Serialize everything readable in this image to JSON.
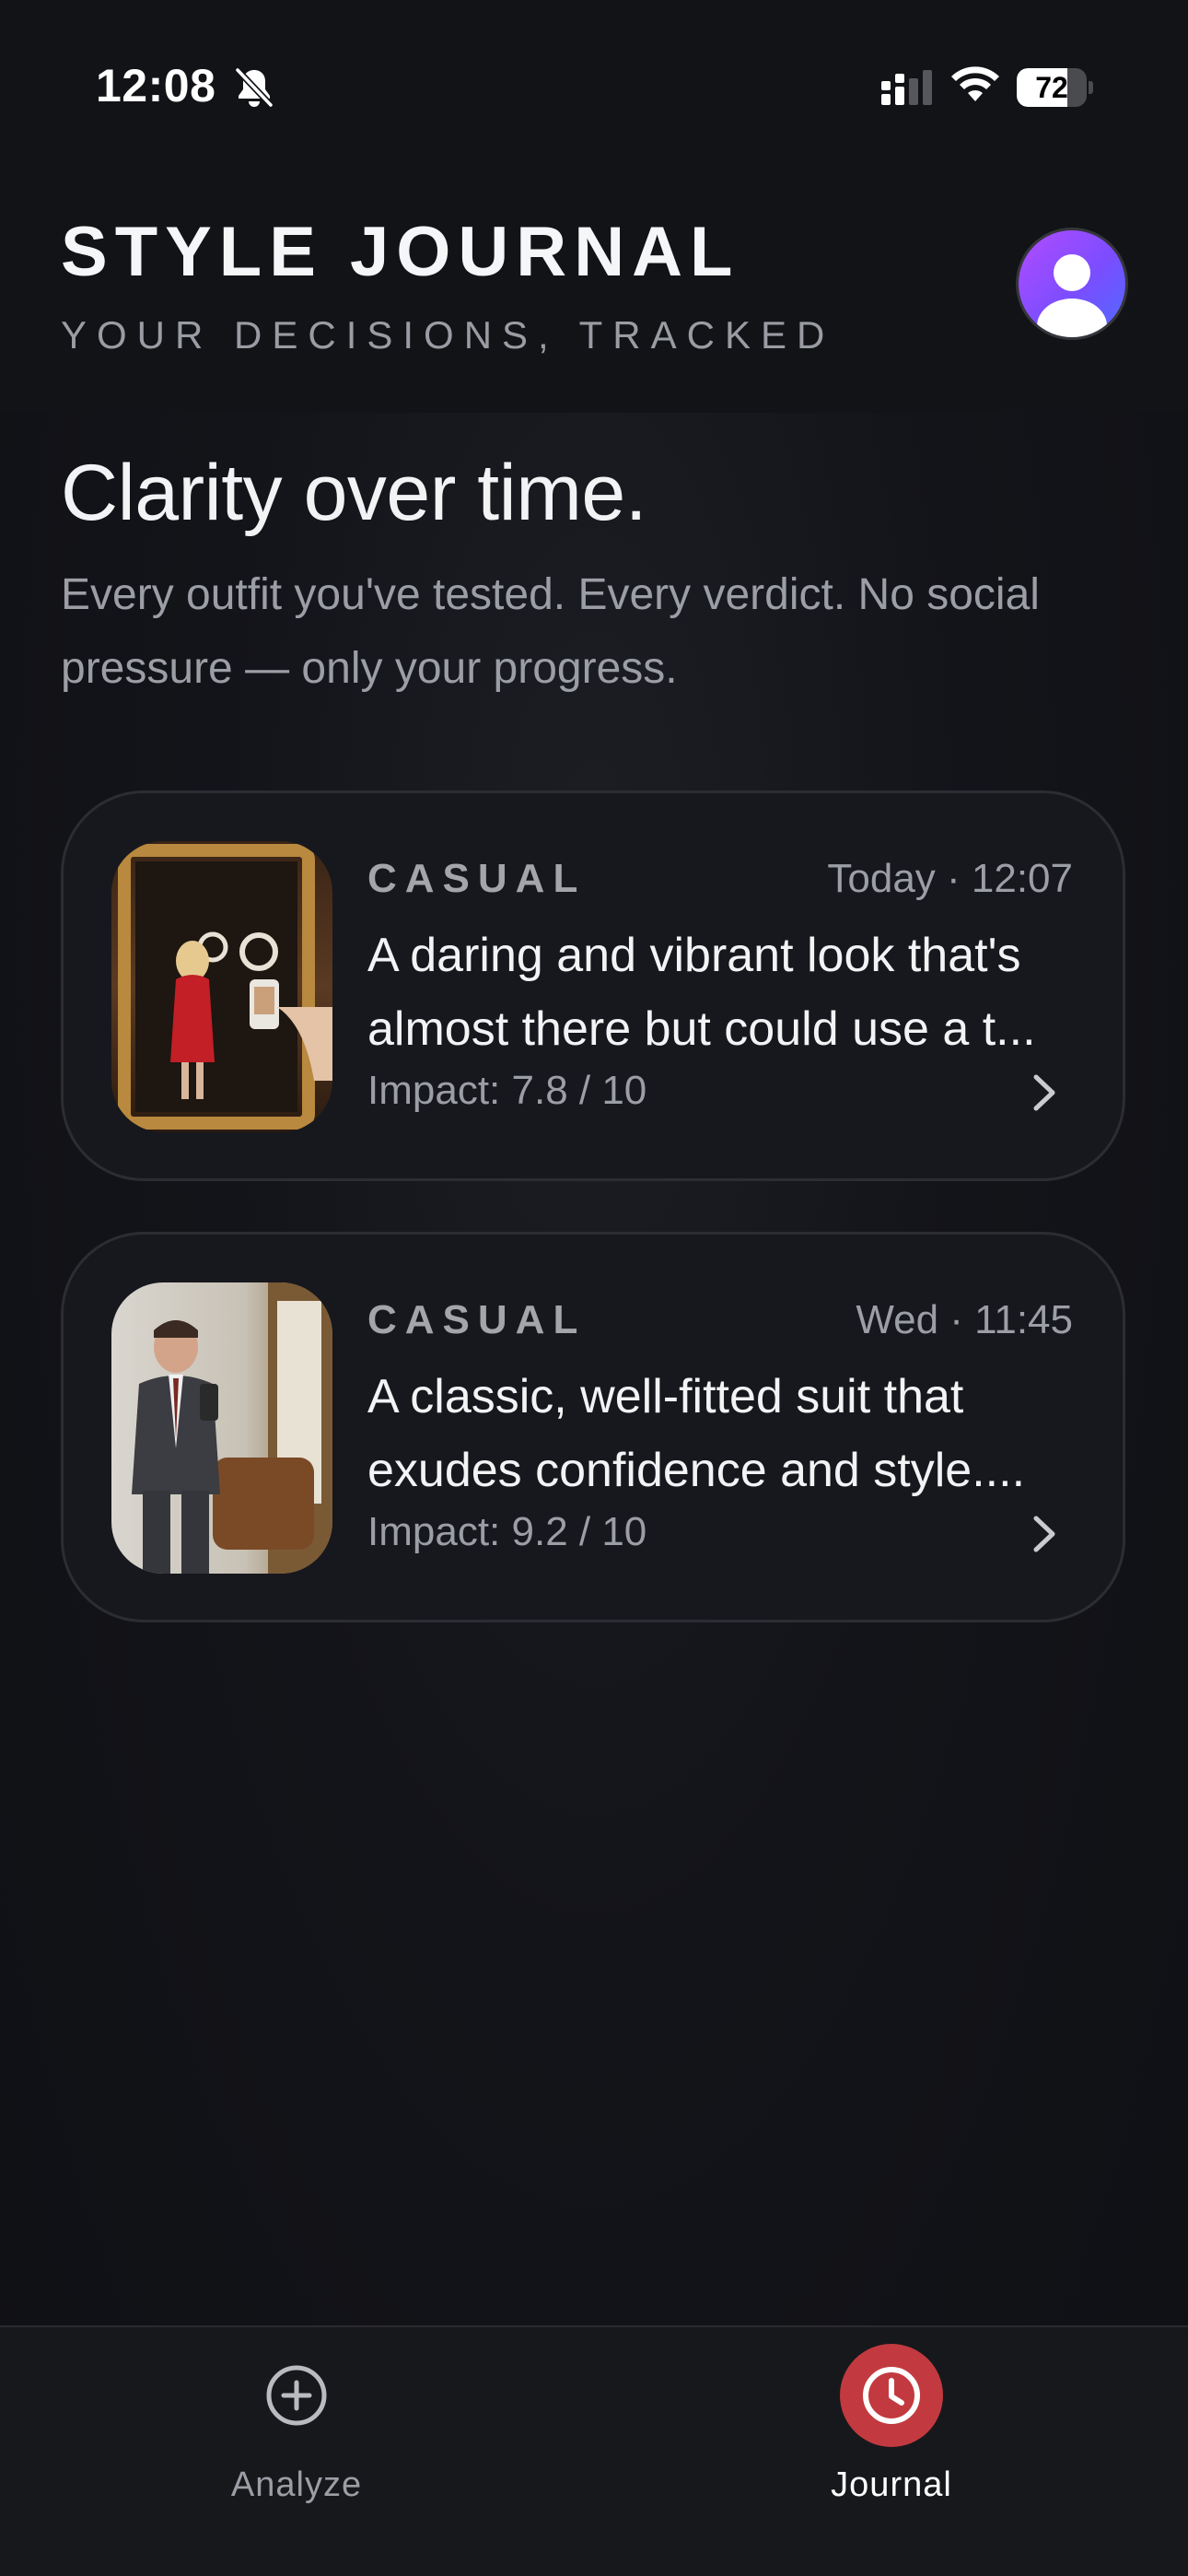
{
  "status_bar": {
    "time": "12:08",
    "battery_percent": "72",
    "battery_level": 0.72
  },
  "header": {
    "title": "STYLE JOURNAL",
    "subtitle": "YOUR DECISIONS, TRACKED"
  },
  "hero": {
    "title": "Clarity over time.",
    "text": "Every outfit you've tested. Every verdict. No social pressure — only your progress."
  },
  "entries": [
    {
      "category": "CASUAL",
      "time": "Today · 12:07",
      "description_line1": "A daring and vibrant look that's",
      "description_line2": "almost there but could use a t...",
      "impact": "Impact: 7.8 / 10"
    },
    {
      "category": "CASUAL",
      "time": "Wed · 11:45",
      "description_line1": "A classic, well-fitted suit that",
      "description_line2": "exudes confidence and style....",
      "impact": "Impact: 9.2 / 10"
    }
  ],
  "tabbar": {
    "analyze_label": "Analyze",
    "journal_label": "Journal",
    "active_tab": "Journal"
  },
  "colors": {
    "background": "#0f1014",
    "accent_red": "#c23a3f",
    "avatar_gradient_start": "#b34cff",
    "avatar_gradient_end": "#4f6bff"
  }
}
